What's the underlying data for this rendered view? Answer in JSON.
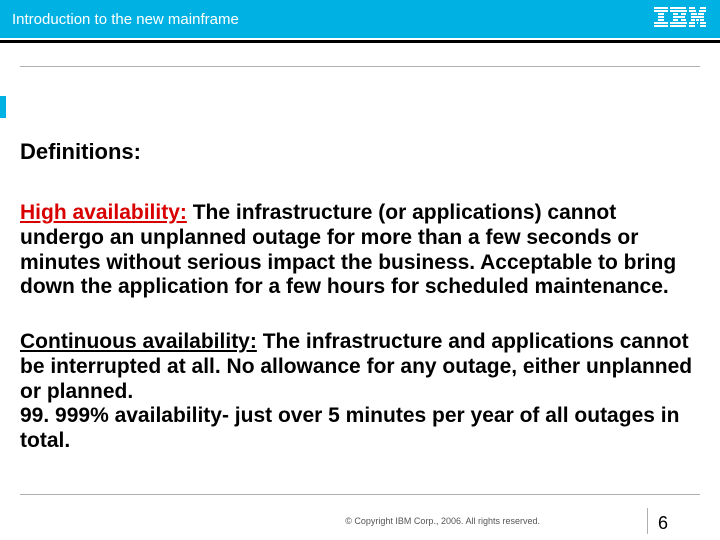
{
  "header": {
    "title": "Introduction to the new mainframe",
    "logo_name": "ibm-logo"
  },
  "slide": {
    "section_title": "Definitions:",
    "ha": {
      "term": "High availability:",
      "body": " The infrastructure (or applications) cannot undergo an unplanned outage for more than a few seconds or minutes without serious impact the business. Acceptable  to bring down the application for a few hours for scheduled maintenance."
    },
    "ca": {
      "term": "Continuous availability:",
      "body1": " The infrastructure and applications cannot be interrupted at all. No allowance for any outage, either unplanned or planned.",
      "body2": "99. 999% availability- just over 5 minutes per year of all outages in total."
    }
  },
  "footer": {
    "copyright": "© Copyright IBM Corp., 2006. All rights reserved.",
    "page_number": "6"
  }
}
